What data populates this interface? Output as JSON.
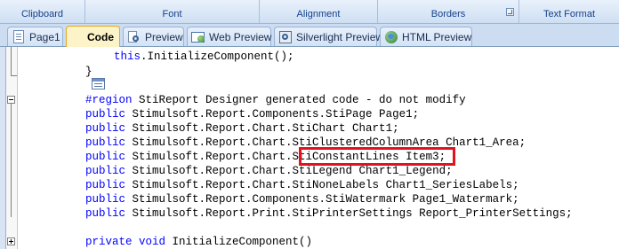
{
  "ribbon": {
    "groups": [
      "Clipboard",
      "Font",
      "Alignment",
      "Borders",
      "Text Format"
    ]
  },
  "tabs": [
    {
      "label": "Page1",
      "icon": "page-icon"
    },
    {
      "label": "Code",
      "icon": "code-icon",
      "active": true
    },
    {
      "label": "Preview",
      "icon": "preview-icon"
    },
    {
      "label": "Web Preview",
      "icon": "web-preview-icon"
    },
    {
      "label": "Silverlight Preview",
      "icon": "silverlight-preview-icon"
    },
    {
      "label": "HTML Preview",
      "icon": "html-preview-icon"
    }
  ],
  "code": {
    "line1_kw": "this",
    "line1_rest": ".InitializeComponent();",
    "line2": "}",
    "line3_kw": "#region",
    "line3_rest": " StiReport Designer generated code - do not modify",
    "line4_kw": "public",
    "line4_rest": " Stimulsoft.Report.Components.StiPage Page1;",
    "line5_kw": "public",
    "line5_rest": " Stimulsoft.Report.Chart.StiChart Chart1;",
    "line6_kw": "public",
    "line6_rest": " Stimulsoft.Report.Chart.StiClusteredColumnArea Chart1_Area;",
    "line7_kw": "public",
    "line7_rest": " Stimulsoft.Report.Chart.StiConstantLines Item3;",
    "line8_kw": "public",
    "line8_rest": " Stimulsoft.Report.Chart.StiLegend Chart1_Legend;",
    "line9_kw": "public",
    "line9_rest": " Stimulsoft.Report.Chart.StiNoneLabels Chart1_SeriesLabels;",
    "line10_kw": "public",
    "line10_rest": " Stimulsoft.Report.Components.StiWatermark Page1_Watermark;",
    "line11_kw": "public",
    "line11_rest": " Stimulsoft.Report.Print.StiPrinterSettings Report_PrinterSettings;",
    "line12_kw": "private void",
    "line12_rest": " InitializeComponent()"
  },
  "colors": {
    "keyword": "#0000ff",
    "highlight_border": "#e0141e",
    "active_tab": "#fdf3c8"
  }
}
